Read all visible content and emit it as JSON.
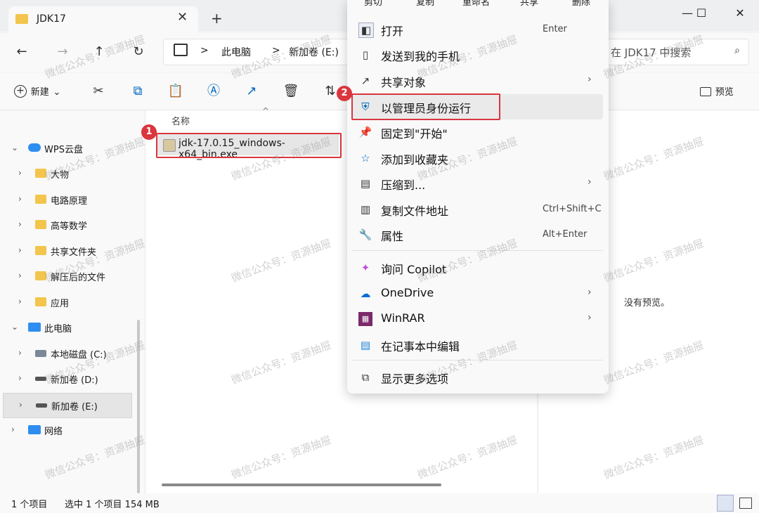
{
  "tab": {
    "title": "JDK17",
    "close": "✕",
    "new": "+"
  },
  "window": {
    "minimize": "—",
    "maximize": "☐",
    "close": "✕"
  },
  "nav": {
    "back": "←",
    "forward": "→",
    "up": "↑",
    "refresh": "↻"
  },
  "breadcrumb": {
    "sep1": ">",
    "pc": "此电脑",
    "sep2": ">",
    "drive": "新加卷 (E:)"
  },
  "search": {
    "placeholder": "在 JDK17 中搜索",
    "icon": "⌕"
  },
  "toolbar": {
    "new_label": "新建",
    "new_chevron": "⌄",
    "preview_label": "预览"
  },
  "columns": {
    "name": "名称",
    "sort_arrow": "^"
  },
  "file": {
    "name": "jdk-17.0.15_windows-x64_bin.exe"
  },
  "sidebar": [
    {
      "label": "WPS云盘",
      "expanded": true
    },
    {
      "label": "大物"
    },
    {
      "label": "电路原理"
    },
    {
      "label": "高等数学"
    },
    {
      "label": "共享文件夹"
    },
    {
      "label": "解压后的文件"
    },
    {
      "label": "应用"
    },
    {
      "label": "此电脑",
      "expanded": true
    },
    {
      "label": "本地磁盘 (C:)"
    },
    {
      "label": "新加卷 (D:)"
    },
    {
      "label": "新加卷 (E:)",
      "selected": true
    },
    {
      "label": "网络"
    }
  ],
  "menu": {
    "top_actions": [
      "剪切",
      "复制",
      "重命名",
      "共享",
      "删除"
    ],
    "items": [
      {
        "label": "打开",
        "shortcut": "Enter",
        "icon": "open-icon"
      },
      {
        "label": "发送到我的手机",
        "icon": "phone-icon"
      },
      {
        "label": "共享对象",
        "arrow": "›",
        "icon": "share-icon"
      },
      {
        "label": "以管理员身份运行",
        "icon": "admin-shield-icon"
      },
      {
        "label": "固定到\"开始\"",
        "icon": "pin-icon"
      },
      {
        "label": "添加到收藏夹",
        "icon": "star-icon"
      },
      {
        "label": "压缩到...",
        "arrow": "›",
        "icon": "zip-icon"
      },
      {
        "label": "复制文件地址",
        "shortcut": "Ctrl+Shift+C",
        "icon": "copy-path-icon"
      },
      {
        "label": "属性",
        "shortcut": "Alt+Enter",
        "icon": "wrench-icon"
      },
      {
        "label": "询问 Copilot",
        "icon": "copilot-icon"
      },
      {
        "label": "OneDrive",
        "arrow": "›",
        "icon": "onedrive-icon"
      },
      {
        "label": "WinRAR",
        "arrow": "›",
        "icon": "winrar-icon"
      },
      {
        "label": "在记事本中编辑",
        "icon": "notepad-icon"
      },
      {
        "label": "显示更多选项",
        "icon": "more-options-icon"
      }
    ]
  },
  "badges": {
    "one": "1",
    "two": "2"
  },
  "preview": {
    "empty": "没有预览。"
  },
  "status": {
    "count": "1 个项目",
    "selected": "选中 1 个项目  154 MB"
  },
  "watermark": "微信公众号：资源抽屉",
  "colors": {
    "highlight": "#d9363e",
    "folder": "#f4c54c",
    "accent": "#0067c0"
  }
}
